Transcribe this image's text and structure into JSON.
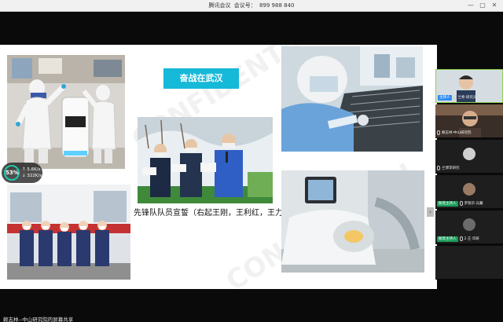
{
  "window": {
    "app_name": "腾讯会议",
    "id_label": "会议号：",
    "meeting_id": "899 988 840",
    "minimize": "—",
    "maximize": "▢",
    "close": "✕"
  },
  "slide": {
    "badge": "奋战在武汉",
    "caption": "先锋队队员宣誓（右起王刚，王利红，王力）",
    "watermark": "CONFIDENTIAL"
  },
  "network": {
    "percent": "53%",
    "up": "↑ 5.6K/s",
    "down": "↓ 322K/s"
  },
  "participants": [
    {
      "role": "主持人",
      "name": "兰希·研究员",
      "role_color": "#2e8bf0"
    },
    {
      "role": "",
      "name": "赖志林·中山研究院",
      "role_color": ""
    },
    {
      "role": "",
      "name": "兰博李研究",
      "role_color": ""
    },
    {
      "role": "联席主持人",
      "name": "罗锐华-兵戴",
      "role_color": "#1a9c5a"
    },
    {
      "role": "联席主持人",
      "name": "2.王·华研",
      "role_color": "#1a9c5a"
    },
    {
      "role": "",
      "name": "",
      "role_color": ""
    }
  ],
  "footer": {
    "share_text": "赖志林--中山研究院的屏幕共享"
  },
  "colors": {
    "accent": "#16b9d8",
    "host_tag": "#2e8bf0",
    "cohost_tag": "#1a9c5a",
    "active_speaker": "#8bd34f"
  }
}
